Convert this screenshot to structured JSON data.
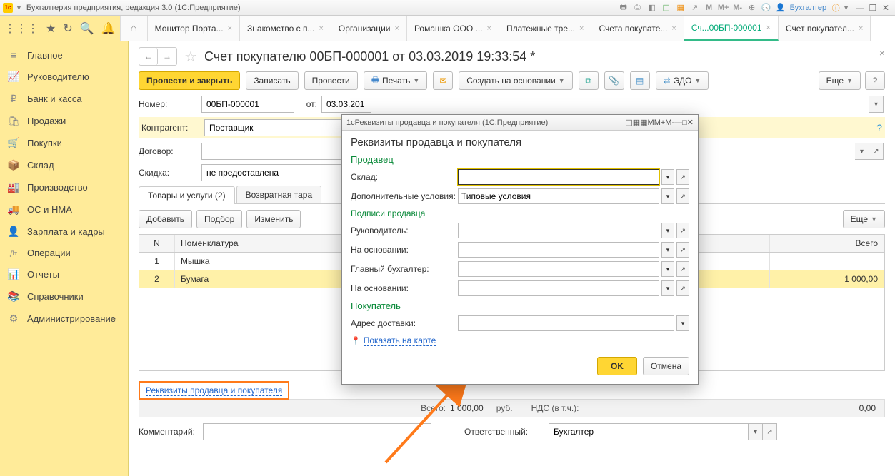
{
  "titlebar": {
    "app_title": "Бухгалтерия предприятия, редакция 3.0  (1С:Предприятие)",
    "user_label": "Бухгалтер",
    "m": "M",
    "mplus": "M+",
    "mminus": "M-"
  },
  "tabs": [
    {
      "label": "Монитор Порта..."
    },
    {
      "label": "Знакомство с п..."
    },
    {
      "label": "Организации"
    },
    {
      "label": "Ромашка ООО ..."
    },
    {
      "label": "Платежные тре..."
    },
    {
      "label": "Счета покупате..."
    },
    {
      "label": "Сч...00БП-000001",
      "active": true
    },
    {
      "label": "Счет покупател..."
    }
  ],
  "sidebar": [
    {
      "icon": "≡",
      "label": "Главное"
    },
    {
      "icon": "📈",
      "label": "Руководителю"
    },
    {
      "icon": "₽",
      "label": "Банк и касса"
    },
    {
      "icon": "🛍",
      "label": "Продажи"
    },
    {
      "icon": "🛒",
      "label": "Покупки"
    },
    {
      "icon": "📦",
      "label": "Склад"
    },
    {
      "icon": "🏭",
      "label": "Производство"
    },
    {
      "icon": "🚚",
      "label": "ОС и НМА"
    },
    {
      "icon": "👤",
      "label": "Зарплата и кадры"
    },
    {
      "icon": "Дт",
      "label": "Операции"
    },
    {
      "icon": "📊",
      "label": "Отчеты"
    },
    {
      "icon": "📚",
      "label": "Справочники"
    },
    {
      "icon": "⚙",
      "label": "Администрирование"
    }
  ],
  "doc": {
    "title": "Счет покупателю 00БП-000001 от 03.03.2019 19:33:54 *",
    "cmd": {
      "post_close": "Провести и закрыть",
      "write": "Записать",
      "post": "Провести",
      "print": "Печать",
      "create_based": "Создать на основании",
      "edo": "ЭДО",
      "more": "Еще"
    },
    "fields": {
      "number_label": "Номер:",
      "number": "00БП-000001",
      "date_label": "от:",
      "date": "03.03.201",
      "contragent_label": "Контрагент:",
      "contragent": "Поставщик",
      "contract_label": "Договор:",
      "contract": "",
      "discount_label": "Скидка:",
      "discount": "не предоставлена"
    },
    "goods_tab": "Товары и услуги (2)",
    "tare_tab": "Возвратная тара",
    "subcmd": {
      "add": "Добавить",
      "pick": "Подбор",
      "edit": "Изменить",
      "more": "Еще"
    },
    "grid": {
      "col_n": "N",
      "col_name": "Номенклатура",
      "col_total": "Всего",
      "rows": [
        {
          "n": "1",
          "name": "Мышка",
          "total": ""
        },
        {
          "n": "2",
          "name": "Бумага",
          "total": "1 000,00"
        }
      ]
    },
    "link": "Реквизиты продавца и покупателя",
    "totals": {
      "label": "Всего:",
      "sum": "1 000,00",
      "cur": "руб.",
      "vat_label": "НДС (в т.ч.):",
      "vat": "0,00"
    },
    "comment_label": "Комментарий:",
    "responsible_label": "Ответственный:",
    "responsible": "Бухгалтер"
  },
  "modal": {
    "wintitle": "Реквизиты продавца и покупателя  (1С:Предприятие)",
    "title": "Реквизиты продавца и покупателя",
    "seller": "Продавец",
    "warehouse": "Склад:",
    "extra": "Дополнительные условия:",
    "extra_val": "Типовые условия",
    "sign": "Подписи продавца",
    "head": "Руководитель:",
    "basis1": "На основании:",
    "accountant": "Главный бухгалтер:",
    "basis2": "На основании:",
    "buyer": "Покупатель",
    "delivery": "Адрес доставки:",
    "maplink": "Показать на карте",
    "ok": "OK",
    "cancel": "Отмена"
  }
}
